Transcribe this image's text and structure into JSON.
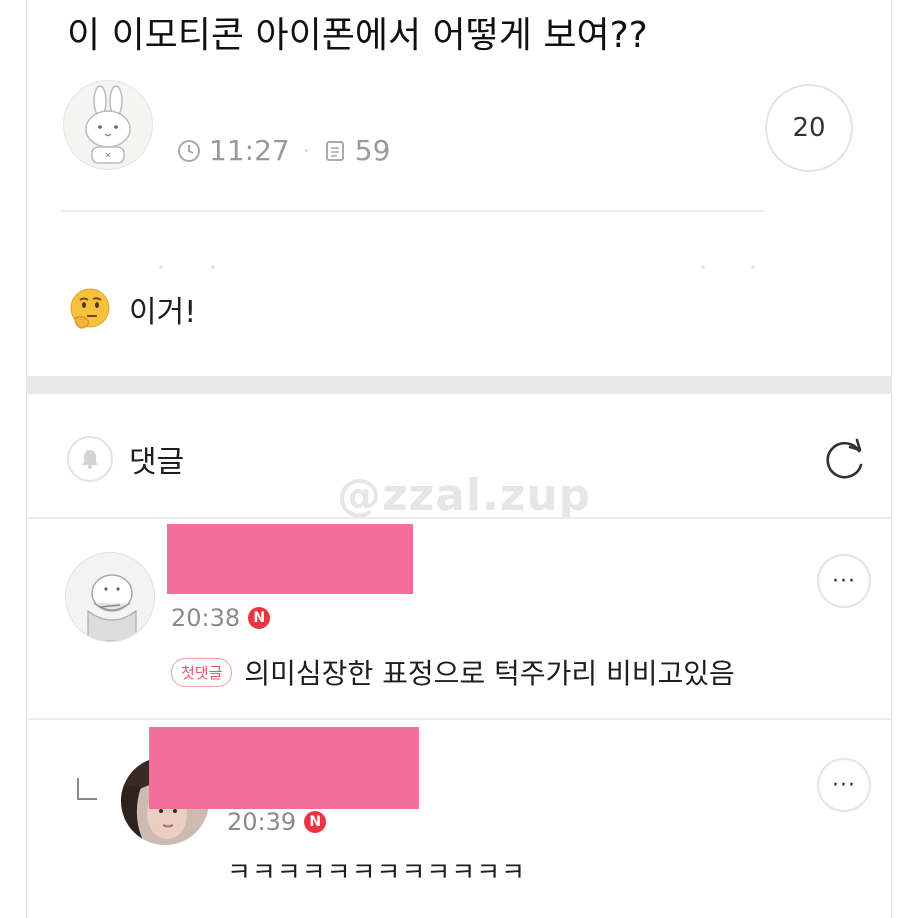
{
  "post": {
    "title": "이 이모티콘 아이폰에서 어떻게 보여??",
    "time": "11:27",
    "views": "59",
    "separator": "·",
    "comment_count": "20",
    "body_text": "이거!"
  },
  "comments": {
    "header_label": "댓글",
    "watermark": "@zzal.zup",
    "items": [
      {
        "time": "20:38",
        "new_badge": "N",
        "first_badge": "첫댓글",
        "text": "의미심장한 표정으로 턱주가리 비비고있음",
        "more": "···"
      },
      {
        "time": "20:39",
        "new_badge": "N",
        "text": "ㅋㅋㅋㅋㅋㅋㅋㅋㅋㅋㅋㅋ",
        "more": "···"
      }
    ]
  },
  "colors": {
    "redaction": "#f16f9a",
    "new_badge": "#e8353f",
    "first_badge": "#e25a66"
  },
  "icons": [
    "clock-icon",
    "document-icon",
    "thinking-face-icon",
    "bell-icon",
    "refresh-icon",
    "more-icon",
    "reply-arrow-icon"
  ]
}
